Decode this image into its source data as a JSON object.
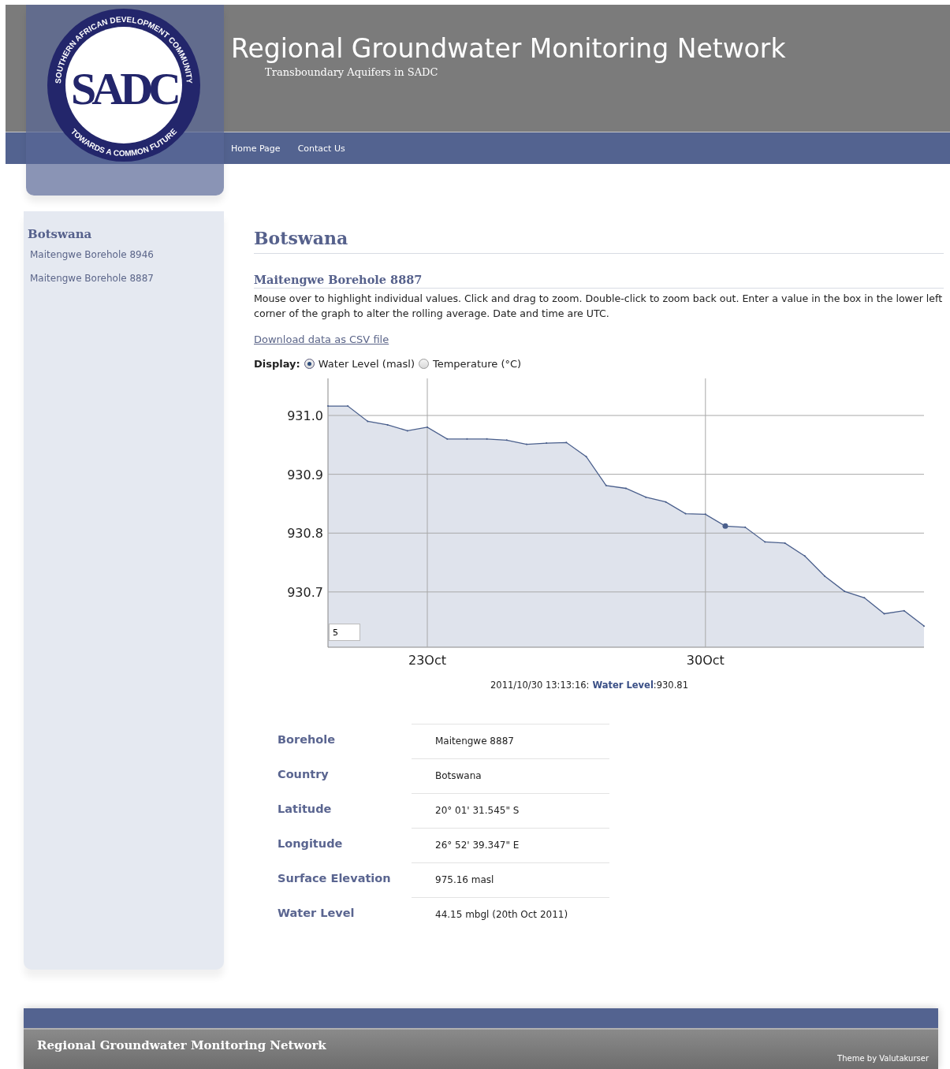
{
  "logo": {
    "ring_top": "SOUTHERN AFRICAN DEVELOPMENT COMMUNITY",
    "ring_bottom": "TOWARDS A COMMON FUTURE",
    "monogram": "SADC"
  },
  "header": {
    "title": "Regional Groundwater Monitoring Network",
    "subtitle": "Transboundary Aquifers in SADC"
  },
  "nav": [
    {
      "label": "Home Page"
    },
    {
      "label": "Contact Us"
    }
  ],
  "sidebar": {
    "heading": "Botswana",
    "items": [
      {
        "label": "Maitengwe Borehole 8946"
      },
      {
        "label": "Maitengwe Borehole 8887"
      }
    ]
  },
  "content": {
    "heading": "Botswana",
    "subheading": "Maitengwe Borehole 8887",
    "description": "Mouse over to highlight individual values. Click and drag to zoom. Double-click to zoom back out. Enter a value in the box in the lower left corner of the graph to alter the rolling average. Date and time are UTC.",
    "download_link": "Download data as CSV file",
    "display": {
      "label": "Display:",
      "options": [
        {
          "label": "Water Level (masl)",
          "selected": true
        },
        {
          "label": "Temperature (°C)",
          "selected": false
        }
      ]
    },
    "chart": {
      "rolling_average": "5",
      "chart_data": {
        "type": "area",
        "categories": [
          null,
          null,
          null,
          null,
          null,
          "23Oct",
          null,
          null,
          null,
          null,
          null,
          null,
          null,
          null,
          null,
          null,
          null,
          null,
          null,
          "30Oct",
          null,
          null,
          null,
          null,
          null,
          null,
          null,
          null,
          null,
          null,
          null
        ],
        "series": [
          {
            "name": "Water Level",
            "color": "#4a5f8c",
            "values": [
              931.016,
              931.016,
              930.99,
              930.984,
              930.974,
              930.98,
              930.96,
              930.96,
              930.96,
              930.958,
              930.951,
              930.953,
              930.954,
              930.93,
              930.881,
              930.876,
              930.861,
              930.853,
              930.833,
              930.832,
              930.812,
              930.81,
              930.785,
              930.783,
              930.761,
              930.727,
              930.701,
              930.69,
              930.663,
              930.668,
              930.642
            ]
          }
        ],
        "ylim": [
          930.606,
          931.063
        ],
        "yticks": [
          {
            "value": 930.7,
            "label": "930.7"
          },
          {
            "value": 930.8,
            "label": "930.8"
          },
          {
            "value": 930.9,
            "label": "930.9"
          },
          {
            "value": 931.0,
            "label": "931.0"
          }
        ],
        "grid": true
      },
      "highlighted": [
        false,
        false,
        false,
        false,
        false,
        false,
        false,
        false,
        false,
        false,
        false,
        false,
        false,
        false,
        false,
        false,
        false,
        false,
        false,
        false,
        true,
        false,
        false,
        false,
        false,
        false,
        false,
        false,
        false,
        false,
        false
      ]
    },
    "readout": {
      "time": "2011/10/30 13:13:16:",
      "value": ":930.81"
    },
    "details": [
      {
        "label": "Borehole",
        "value": "Maitengwe 8887"
      },
      {
        "label": "Country",
        "value": "Botswana"
      },
      {
        "label": "Latitude",
        "value": "20° 01' 31.545\" S"
      },
      {
        "label": "Longitude",
        "value": "26° 52' 39.347\" E"
      },
      {
        "label": "Surface Elevation",
        "value": "975.16 masl"
      },
      {
        "label": "Water Level",
        "value": "44.15 mbgl (20th Oct 2011)"
      }
    ]
  },
  "footer": {
    "title": "Regional Groundwater Monitoring Network",
    "credit": "Theme by Valutakurser"
  }
}
